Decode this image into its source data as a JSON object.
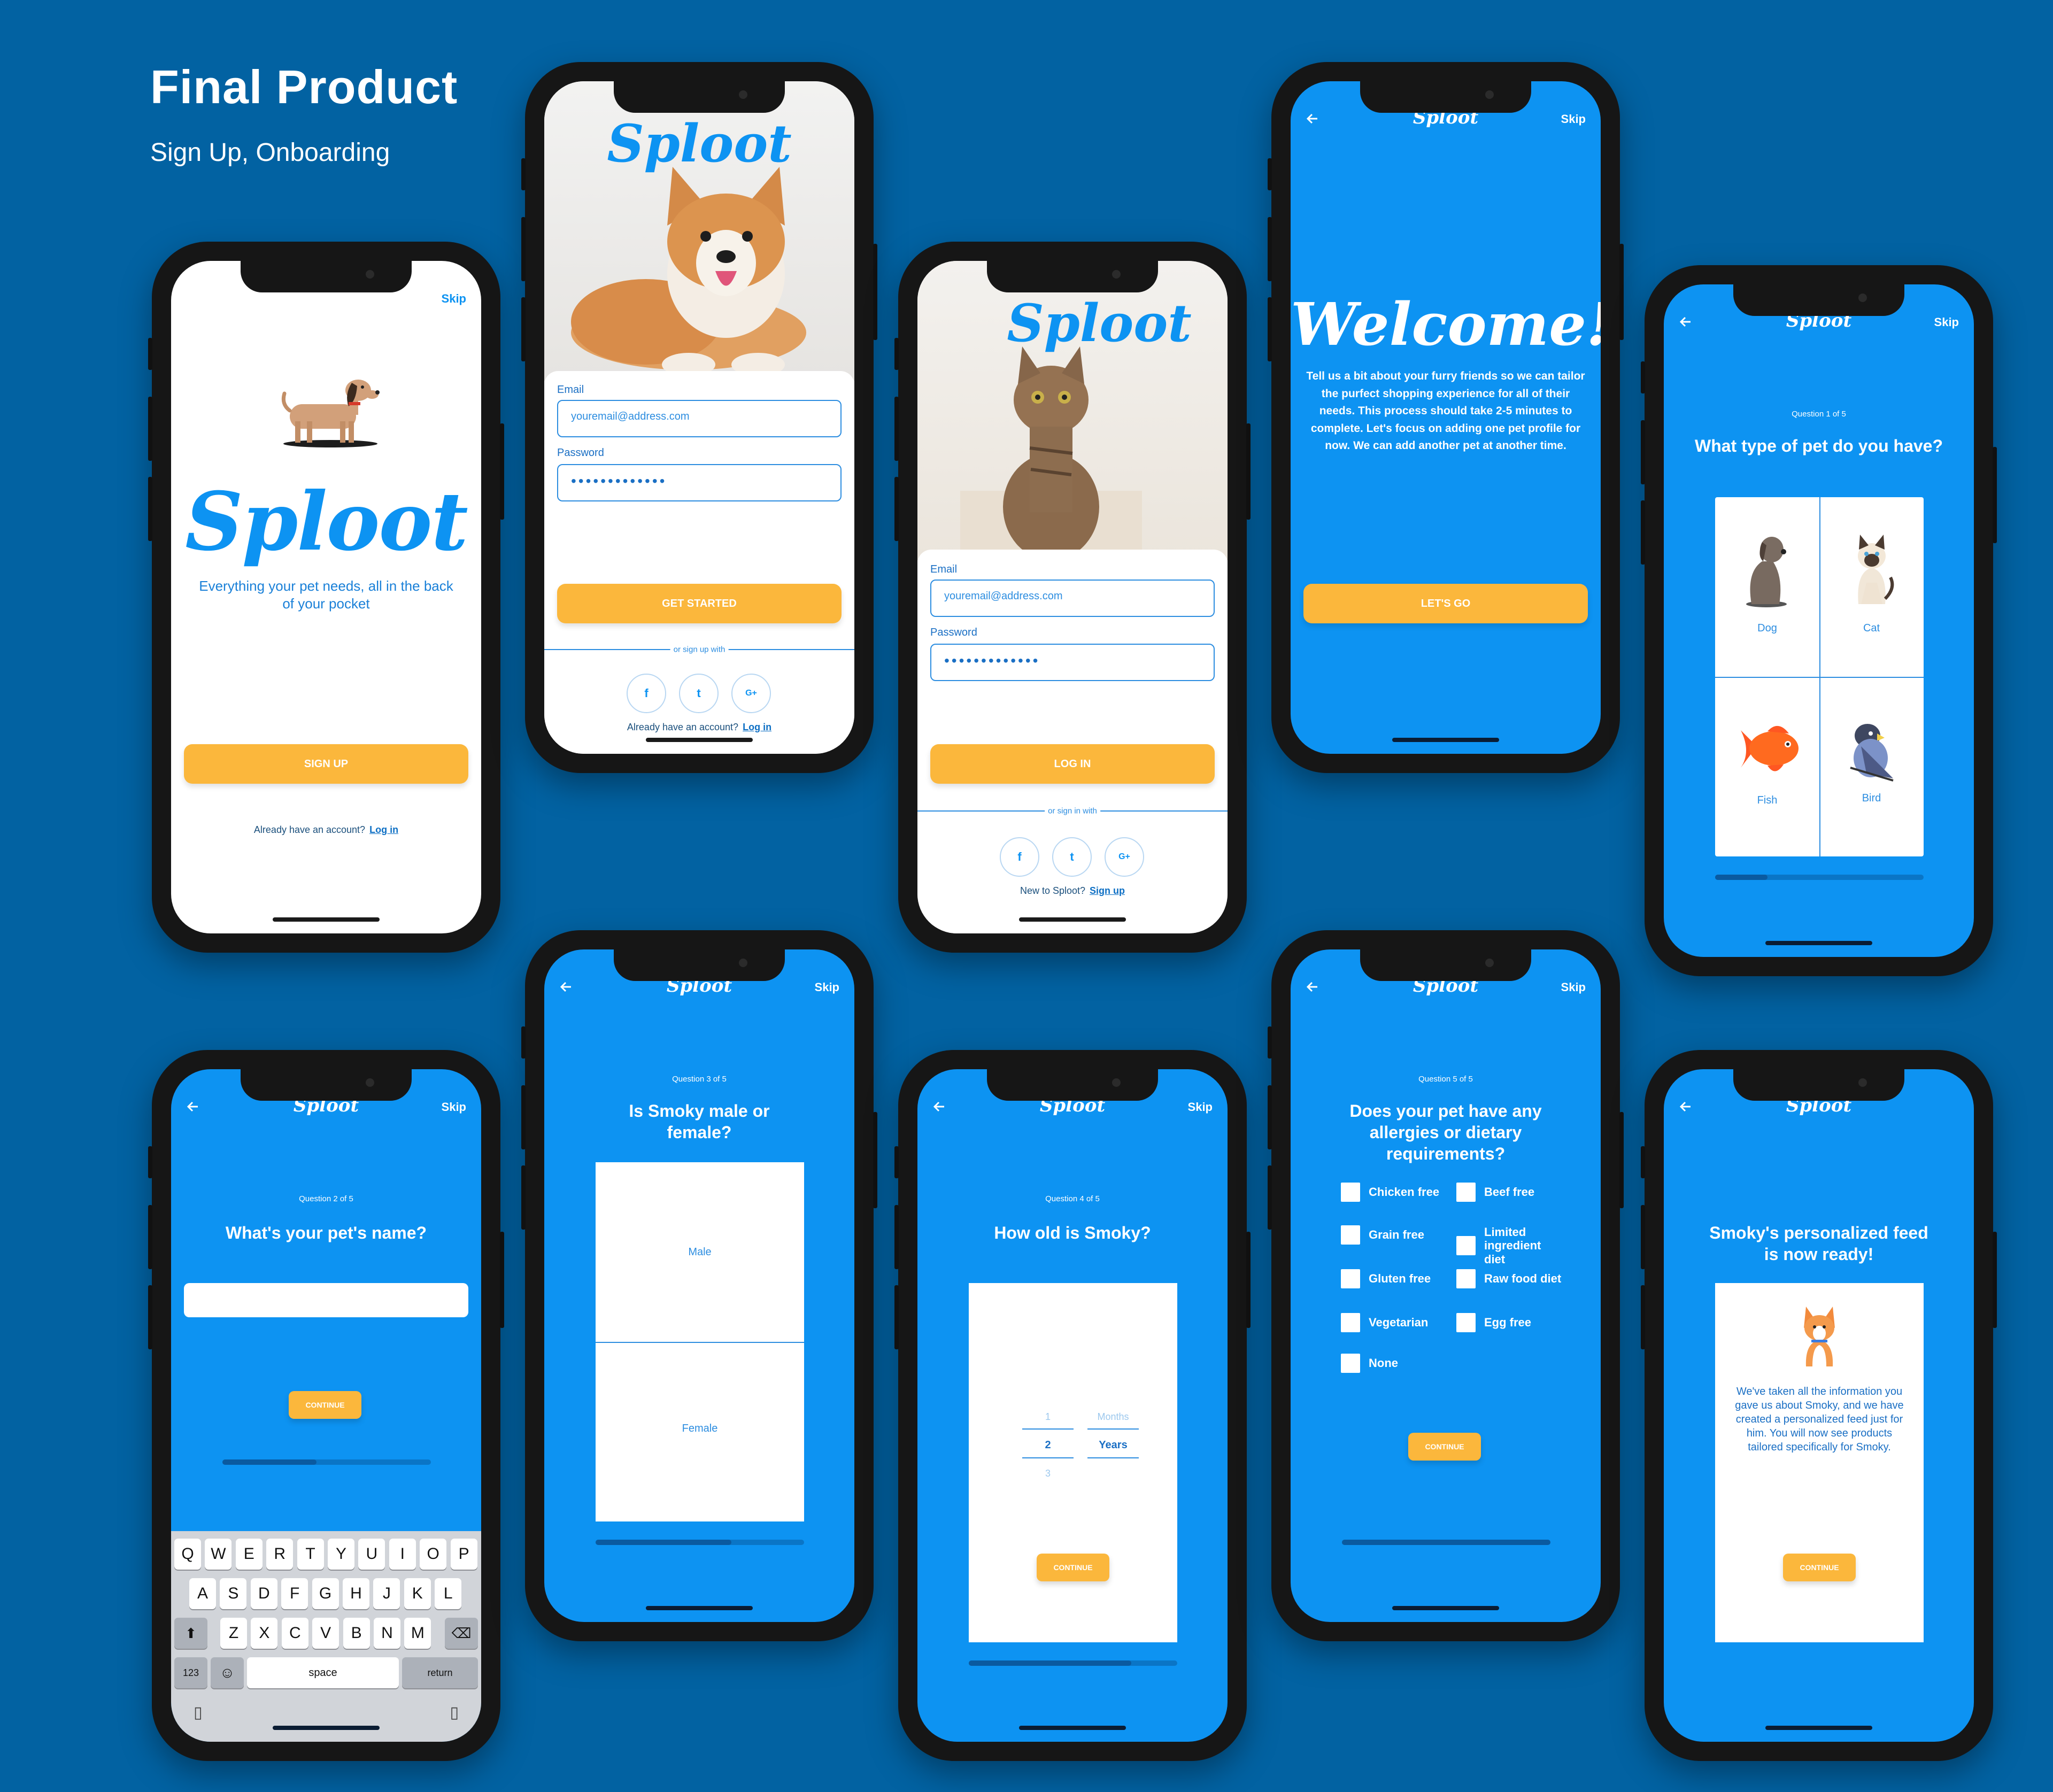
{
  "header": {
    "title": "Final Product",
    "subtitle": "Sign Up, Onboarding"
  },
  "brand": {
    "name": "Sploot",
    "primary": "#0d93f2",
    "accent": "#fbb73c",
    "background": "#0262a2"
  },
  "common": {
    "skip": "Skip"
  },
  "splash": {
    "tagline_line1": "Everything your pet needs, all in the back",
    "tagline_line2": "of your pocket",
    "signup_button": "SIGN UP",
    "account_prompt": "Already have an account?",
    "login_link": "Log in"
  },
  "signup": {
    "email_label": "Email",
    "email_placeholder": "youremail@address.com",
    "password_label": "Password",
    "password_value": "•••••••••••••",
    "submit": "GET STARTED",
    "divider": "or sign up with",
    "social": [
      "f",
      "t",
      "G+"
    ],
    "account_prompt": "Already have an account?",
    "login_link": "Log in"
  },
  "login": {
    "email_label": "Email",
    "email_placeholder": "youremail@address.com",
    "password_label": "Password",
    "password_value": "•••••••••••••",
    "submit": "LOG IN",
    "divider": "or sign in with",
    "social": [
      "f",
      "t",
      "G+"
    ],
    "new_prompt": "New to Sploot?",
    "signup_link": "Sign up"
  },
  "welcome": {
    "title": "Welcome!",
    "body": "Tell us a bit about your furry friends so we can tailor the purfect shopping experience for all of their needs. This process should take 2-5 minutes to complete. Let's focus on adding one pet profile for now. We can add another pet at another time.",
    "button": "LET'S GO"
  },
  "q1": {
    "number": "Question 1 of 5",
    "title": "What type of pet do you have?",
    "options": [
      "Dog",
      "Cat",
      "Fish",
      "Bird"
    ],
    "progress": 0.25
  },
  "q2": {
    "number": "Question 2 of 5",
    "title": "What's your pet's name?",
    "input_value": "",
    "button": "CONTINUE",
    "progress": 0.45,
    "keyboard": {
      "row1": [
        "Q",
        "W",
        "E",
        "R",
        "T",
        "Y",
        "U",
        "I",
        "O",
        "P"
      ],
      "row2": [
        "A",
        "S",
        "D",
        "F",
        "G",
        "H",
        "J",
        "K",
        "L"
      ],
      "row3": [
        "Z",
        "X",
        "C",
        "V",
        "B",
        "N",
        "M"
      ],
      "numbers": "123",
      "space": "space",
      "return": "return"
    }
  },
  "q3": {
    "number": "Question 3 of 5",
    "title": "Is Smoky male or female?",
    "options": [
      "Male",
      "Female"
    ],
    "progress": 0.65
  },
  "q4": {
    "number": "Question 4 of 5",
    "title": "How old is Smoky?",
    "numbers": [
      "1",
      "2",
      "3"
    ],
    "units": [
      "Months",
      "Years"
    ],
    "button": "CONTINUE",
    "progress": 0.78
  },
  "q5": {
    "number": "Question 5 of 5",
    "title": "Does your pet have any allergies or dietary requirements?",
    "left": [
      "Chicken free",
      "Grain free",
      "Gluten free",
      "Vegetarian",
      "None"
    ],
    "right": [
      "Beef free",
      "Limited ingredient diet",
      "Raw food diet",
      "Egg free"
    ],
    "button": "CONTINUE",
    "progress": 1.0
  },
  "ready": {
    "title": "Smoky's personalized feed is now ready!",
    "body": "We've taken all the information you gave us about Smoky, and we have created a personalized feed just for him. You will now see products tailored specifically for Smoky.",
    "button": "CONTINUE"
  }
}
